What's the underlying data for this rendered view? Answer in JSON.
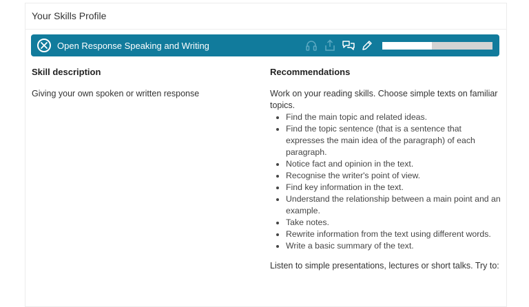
{
  "profile": {
    "title": "Your Skills Profile"
  },
  "skill_bar": {
    "name": "Open Response Speaking and Writing",
    "progress_fraction": 0.45,
    "colors": {
      "bar": "#117b9c",
      "progress_fill": "#ffffff",
      "progress_track": "#d3d3d3"
    },
    "icons": [
      "close-icon",
      "headphones-icon",
      "upload-icon",
      "speech-bubbles-icon",
      "pencil-icon"
    ]
  },
  "skill_description": {
    "heading": "Skill description",
    "text": "Giving your own spoken or written response"
  },
  "recommendations": {
    "heading": "Recommendations",
    "intro": "Work on your reading skills. Choose simple texts on familiar topics.",
    "items": [
      "Find the main topic and related ideas.",
      "Find the topic sentence (that is a sentence that expresses the main idea of the paragraph) of each paragraph.",
      "Notice fact and opinion in the text.",
      "Recognise the writer's point of view.",
      "Find key information in the text.",
      "Understand the relationship between a main point and an example.",
      "Take notes.",
      "Rewrite information from the text using different words.",
      "Write a basic summary of the text."
    ],
    "intro2": "Listen to simple presentations, lectures or short talks. Try to:"
  }
}
